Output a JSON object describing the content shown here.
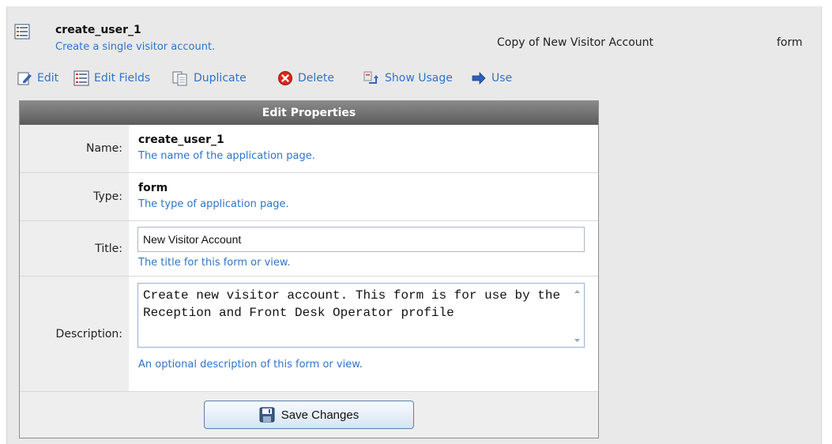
{
  "header": {
    "icon": "form-list-icon",
    "title": "create_user_1",
    "description": "Create a single visitor account.",
    "source": "Copy of New Visitor Account",
    "type": "form"
  },
  "toolbar": {
    "items": [
      {
        "label": "Edit",
        "icon": "edit-icon"
      },
      {
        "label": "Edit Fields",
        "icon": "fields-icon"
      },
      {
        "label": "Duplicate",
        "icon": "duplicate-icon"
      },
      {
        "label": "Delete",
        "icon": "delete-icon"
      },
      {
        "label": "Show Usage",
        "icon": "usage-icon"
      },
      {
        "label": "Use",
        "icon": "arrow-right-icon"
      }
    ]
  },
  "panel": {
    "title": "Edit Properties",
    "name": {
      "label": "Name:",
      "value": "create_user_1",
      "hint": "The name of the application page."
    },
    "type": {
      "label": "Type:",
      "value": "form",
      "hint": "The type of application page."
    },
    "title_field": {
      "label": "Title:",
      "value": "New Visitor Account",
      "hint": "The title for this form or view."
    },
    "description": {
      "label": "Description:",
      "value": "Create new visitor account. This form is for use by the Reception and Front Desk Operator profile",
      "hint": "An optional description of this form or view."
    },
    "save_label": "Save Changes"
  },
  "colors": {
    "link": "#2f74c9",
    "panel_header": "#6f6f6f",
    "label_bg": "#eeeeee",
    "background": "#e9e9e9"
  }
}
